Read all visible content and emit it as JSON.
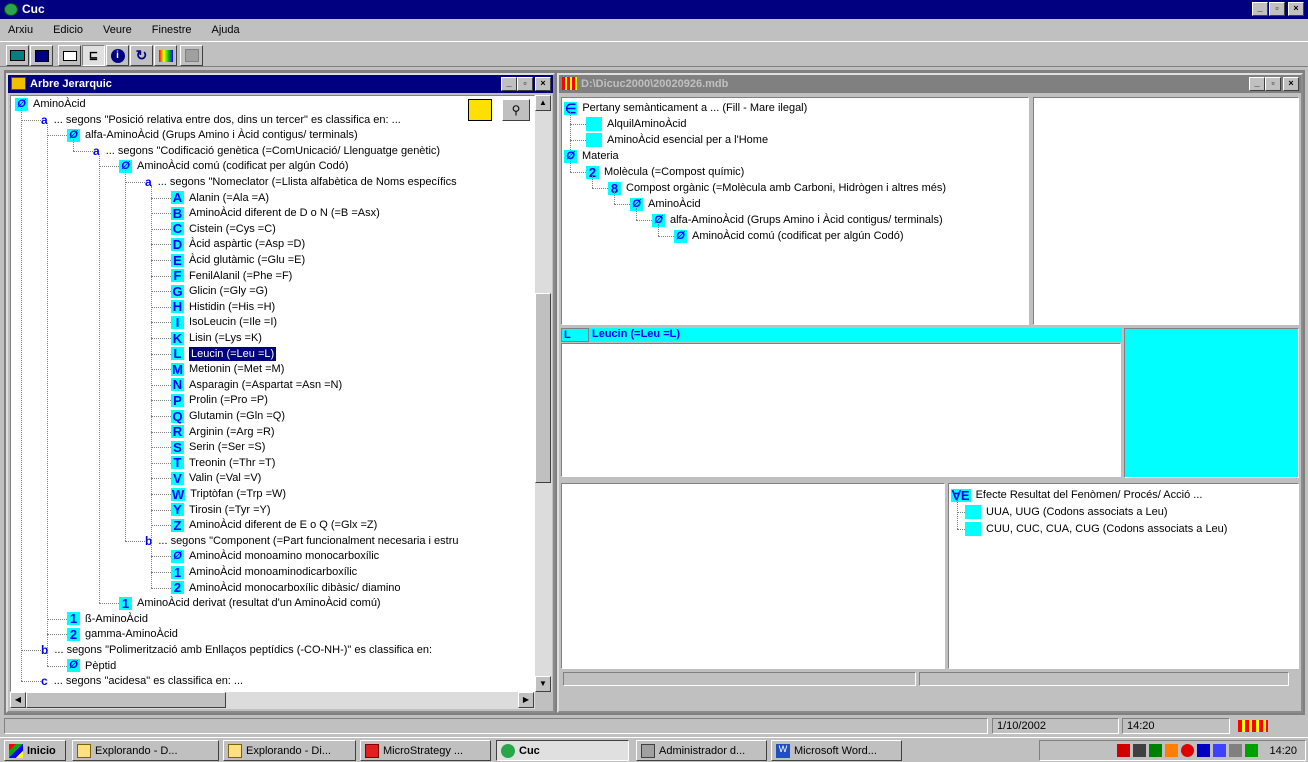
{
  "app": {
    "title": "Cuc"
  },
  "menu": [
    "Arxiu",
    "Edicio",
    "Veure",
    "Finestre",
    "Ajuda"
  ],
  "tree_window": {
    "title": "Arbre Jerarquic",
    "rows": [
      {
        "text": "AminoÀcid",
        "badge": "0",
        "level": 0
      },
      {
        "text": "... segons \"Posició relativa entre dos, dins un tercer\" es classifica en: ...",
        "sub": "a",
        "level": 1
      },
      {
        "text": "alfa-AminoÀcid (Grups Amino i Àcid contigus/ terminals)",
        "badge": "0",
        "level": 2
      },
      {
        "text": "... segons \"Codificació genètica (=ComUnicació/ Llenguatge genètic)",
        "sub": "a",
        "level": 3
      },
      {
        "text": "AminoÀcid comú (codificat per algún Codó)",
        "badge": "0",
        "level": 4
      },
      {
        "text": "... segons \"Nomeclator (=Llista alfabètica de Noms específics",
        "sub": "a",
        "level": 5
      },
      {
        "text": "Alanin (=Ala =A)",
        "badge": "A",
        "level": 6
      },
      {
        "text": "AminoÀcid diferent de D o N (=B =Asx)",
        "badge": "B",
        "level": 6
      },
      {
        "text": "Cistein (=Cys =C)",
        "badge": "C",
        "level": 6
      },
      {
        "text": "Àcid aspàrtic (=Asp =D)",
        "badge": "D",
        "level": 6
      },
      {
        "text": "Àcid glutàmic (=Glu =E)",
        "badge": "E",
        "level": 6
      },
      {
        "text": "FenilAlanil (=Phe =F)",
        "badge": "F",
        "level": 6
      },
      {
        "text": "Glicin (=Gly =G)",
        "badge": "G",
        "level": 6
      },
      {
        "text": "Histidin (=His =H)",
        "badge": "H",
        "level": 6
      },
      {
        "text": "IsoLeucin (=Ile =I)",
        "badge": "I",
        "level": 6
      },
      {
        "text": "Lisin (=Lys =K)",
        "badge": "K",
        "level": 6
      },
      {
        "text": "Leucin (=Leu =L)",
        "badge": "L",
        "level": 6,
        "selected": true
      },
      {
        "text": "Metionin (=Met =M)",
        "badge": "M",
        "level": 6
      },
      {
        "text": "Asparagin (=Aspartat =Asn =N)",
        "badge": "N",
        "level": 6
      },
      {
        "text": "Prolin (=Pro =P)",
        "badge": "P",
        "level": 6
      },
      {
        "text": "Glutamin (=Gln =Q)",
        "badge": "Q",
        "level": 6
      },
      {
        "text": "Arginin (=Arg =R)",
        "badge": "R",
        "level": 6
      },
      {
        "text": "Serin (=Ser =S)",
        "badge": "S",
        "level": 6
      },
      {
        "text": "Treonin (=Thr =T)",
        "badge": "T",
        "level": 6
      },
      {
        "text": "Valin (=Val =V)",
        "badge": "V",
        "level": 6
      },
      {
        "text": "Triptòfan (=Trp =W)",
        "badge": "W",
        "level": 6
      },
      {
        "text": "Tirosin (=Tyr =Y)",
        "badge": "Y",
        "level": 6
      },
      {
        "text": "AminoÀcid diferent de E o Q (=Glx =Z)",
        "badge": "Z",
        "level": 6
      },
      {
        "text": "... segons \"Component (=Part funcionalment necesaria i estru",
        "sub": "b",
        "level": 5
      },
      {
        "text": "AminoÀcid monoamino monocarboxílic",
        "badge": "0",
        "level": 6
      },
      {
        "text": "AminoÀcid monoaminodicarboxílic",
        "badge": "1",
        "level": 6
      },
      {
        "text": "AminoÀcid monocarboxílic dibàsic/ diamino",
        "badge": "2",
        "level": 6
      },
      {
        "text": "AminoÀcid derivat (resultat d'un AminoÀcid comú)",
        "badge": "1",
        "level": 4
      },
      {
        "text": "ß-AminoÀcid",
        "badge": "1",
        "level": 2
      },
      {
        "text": "gamma-AminoÀcid",
        "badge": "2",
        "level": 2
      },
      {
        "text": "... segons \"Polimerització amb Enllaços peptídics (-CO-NH-)\" es classifica en:",
        "sub": "b",
        "level": 1
      },
      {
        "text": "Pèptid",
        "badge": "0",
        "level": 2
      },
      {
        "text": "... segons \"acidesa\" es classifica en: ...",
        "sub": "c",
        "level": 1
      }
    ]
  },
  "db_window": {
    "title": "D:\\Dicuc2000\\20020926.mdb",
    "top_tree": [
      {
        "text": "Pertany semànticament a ... (Fill - Mare ilegal)",
        "badge": "∈",
        "level": 0
      },
      {
        "text": "AlquilAminoÀcid",
        "badge": "",
        "level": 1
      },
      {
        "text": "AminoÀcid esencial per a l'Home",
        "badge": "",
        "level": 1
      },
      {
        "text": "Materia",
        "badge": "0",
        "level": 0
      },
      {
        "text": "Molècula (=Compost químic)",
        "badge": "2",
        "level": 1
      },
      {
        "text": "Compost orgànic (=Molècula amb Carboni, Hidrògen i altres més)",
        "badge": "8",
        "level": 2
      },
      {
        "text": "AminoÀcid",
        "badge": "0",
        "level": 3
      },
      {
        "text": "alfa-AminoÀcid (Grups Amino i Àcid contigus/ terminals)",
        "badge": "0",
        "level": 4
      },
      {
        "text": "AminoÀcid comú (codificat per algún Codó)",
        "badge": "0",
        "level": 5
      }
    ],
    "mid_label_badge": "L",
    "mid_label": "Leucin (=Leu =L)",
    "effects_tree": [
      {
        "text": "Efecte Resultat del Fenòmen/ Procés/ Acció ...",
        "badge": "∀E",
        "level": 0
      },
      {
        "text": "UUA, UUG (Codons associats a Leu)",
        "badge": "",
        "level": 1
      },
      {
        "text": "CUU, CUC, CUA, CUG (Codons associats a Leu)",
        "badge": "",
        "level": 1
      }
    ]
  },
  "status": {
    "date": "1/10/2002",
    "time": "14:20"
  },
  "taskbar": {
    "start": "Inicio",
    "tasks": [
      "Explorando - D...",
      "Explorando - Di...",
      "MicroStrategy ...",
      "Cuc",
      "Administrador d...",
      "Microsoft Word..."
    ],
    "clock": "14:20"
  },
  "colors": {
    "badge_bg": "#00ffff",
    "badge_fg": "#0000ff",
    "title_active": "#000080"
  }
}
